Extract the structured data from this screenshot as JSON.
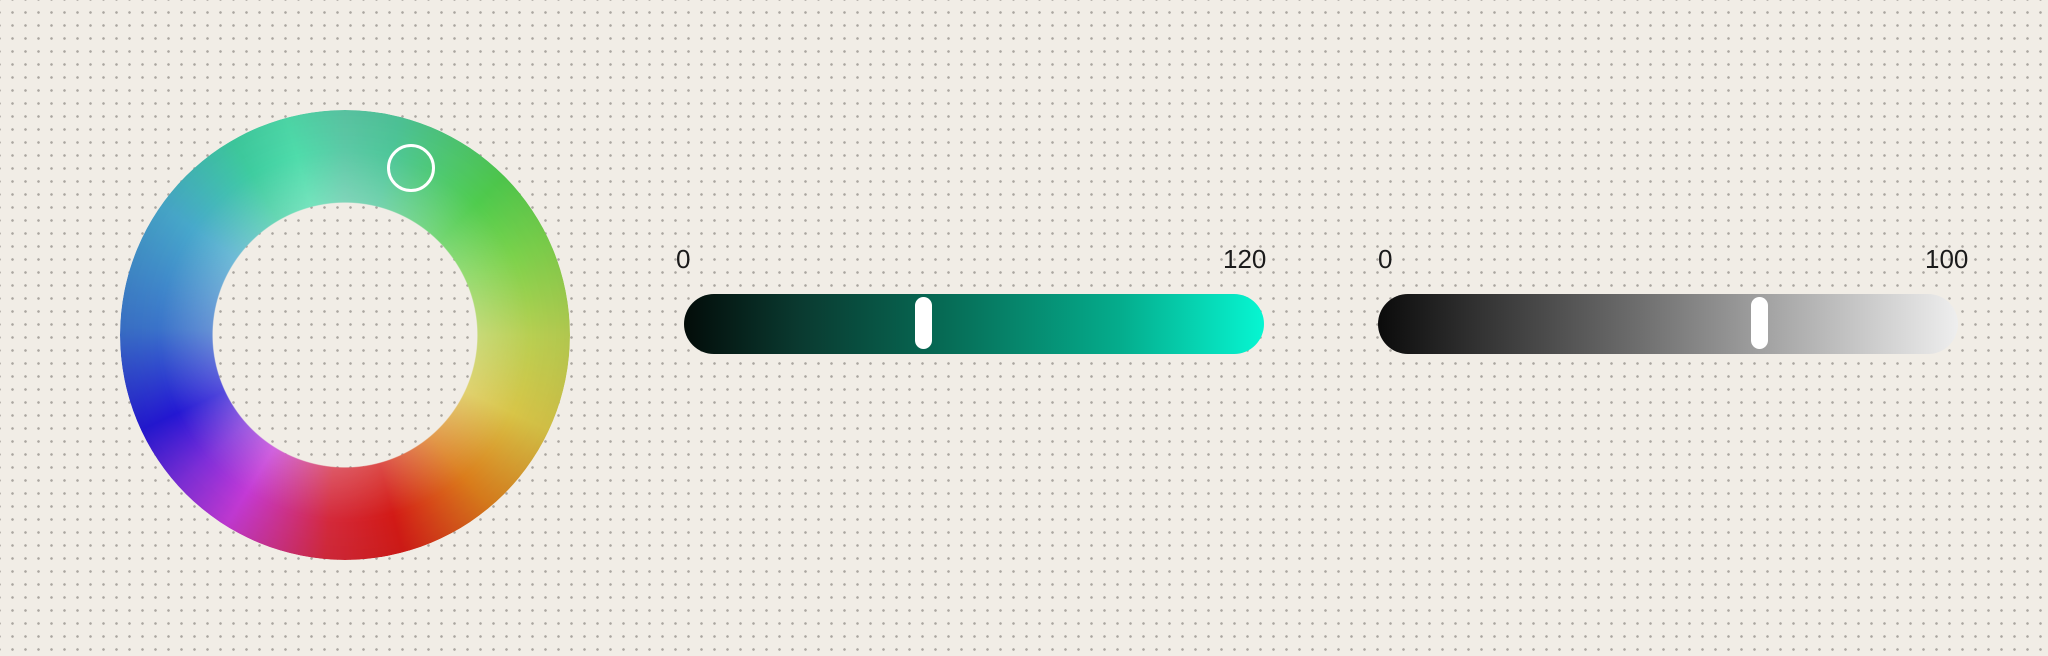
{
  "color_wheel": {
    "hue_degrees": 20,
    "handle_icon": "ring-handle"
  },
  "hue_slider": {
    "min_label": "0",
    "max_label": "120",
    "value": 50,
    "colors": {
      "start": "#030c09",
      "end": "#06f6d2"
    }
  },
  "value_slider": {
    "min_label": "0",
    "max_label": "100",
    "value": 67,
    "colors": {
      "start": "#0b0b0b",
      "end": "#eeeeee"
    }
  },
  "background_color": "#f1ede6"
}
